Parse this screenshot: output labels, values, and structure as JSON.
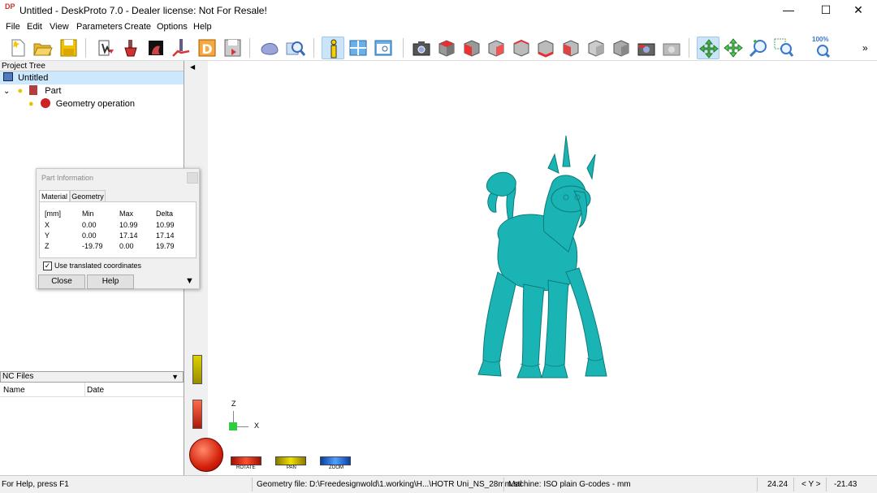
{
  "titlebar": {
    "title": "Untitled - DeskProto 7.0 - Dealer license: Not For Resale!",
    "app_icon": "DP"
  },
  "menu": [
    "File",
    "Edit",
    "View",
    "Parameters",
    "Create",
    "Options",
    "Help"
  ],
  "toolbar": {
    "zoom_label": "100%",
    "overflow": "»"
  },
  "project_tree": {
    "header": "Project Tree",
    "root": "Untitled",
    "part": "Part",
    "operation": "Geometry operation"
  },
  "nc_files": {
    "header": "NC Files",
    "columns": [
      "Name",
      "Date"
    ]
  },
  "dialog": {
    "title": "Part Information",
    "tabs": [
      "Material",
      "Geometry"
    ],
    "columns": [
      "[mm]",
      "Min",
      "Max",
      "Delta"
    ],
    "rows": [
      [
        "X",
        "0.00",
        "10.99",
        "10.99"
      ],
      [
        "Y",
        "0.00",
        "17.14",
        "17.14"
      ],
      [
        "Z",
        "-19.79",
        "0.00",
        "19.79"
      ]
    ],
    "checkbox_label": "Use translated coordinates",
    "close_label": "Close",
    "help_label": "Help"
  },
  "viewport": {
    "axis_z": "Z",
    "axis_x": "X",
    "rotate_label": "ROTATE",
    "pan_label": "PAN",
    "zoom_label": "ZOOM",
    "model_color": "#1bb4b4"
  },
  "statusbar": {
    "help": "For Help, press F1",
    "geometry_file": "Geometry file: D:\\Freedesignwold\\1.working\\H...\\HOTR Uni_NS_28mm.stl",
    "machine": "Machine: ISO plain G-codes - mm",
    "coord_x": "24.24",
    "coord_mode": "< Y >",
    "coord_y": "-21.43"
  }
}
